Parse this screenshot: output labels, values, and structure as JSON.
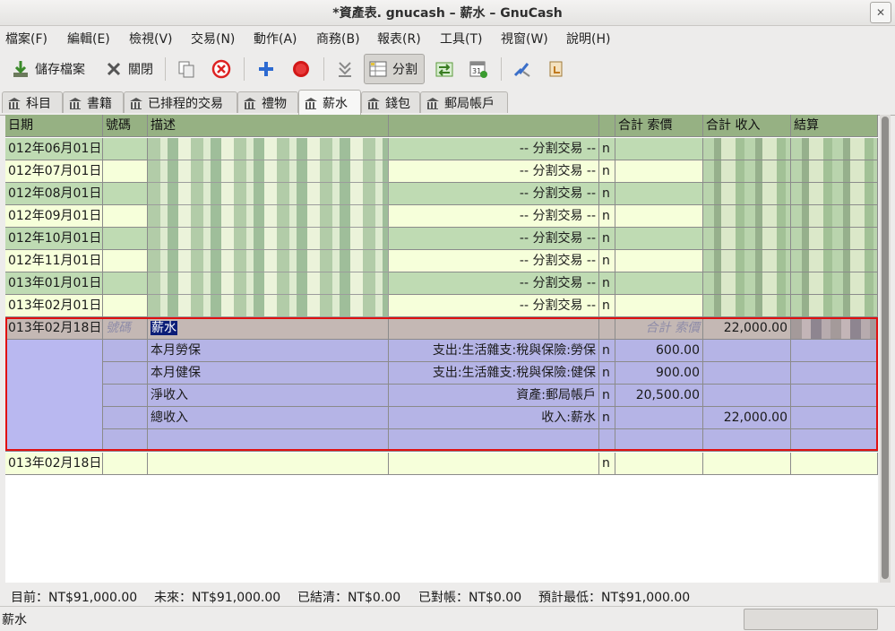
{
  "window": {
    "title": "*資產表. gnucash – 薪水  –  GnuCash"
  },
  "menu": [
    "檔案(F)",
    "編輯(E)",
    "檢視(V)",
    "交易(N)",
    "動作(A)",
    "商務(B)",
    "報表(R)",
    "工具(T)",
    "視窗(W)",
    "說明(H)"
  ],
  "toolbar": {
    "save": "儲存檔案",
    "close": "關閉",
    "split": "分割"
  },
  "tabs": [
    "科目",
    "書籍",
    "已排程的交易",
    "禮物",
    "薪水",
    "錢包",
    "郵局帳戶"
  ],
  "columns": {
    "date": "日期",
    "num": "號碼",
    "desc": "描述",
    "debit": "合計 索價",
    "credit": "合計 收入",
    "balance": "結算"
  },
  "split_label": "-- 分割交易 --",
  "reconcile": "n",
  "transactions": [
    {
      "date": "012年06月01日"
    },
    {
      "date": "012年07月01日"
    },
    {
      "date": "012年08月01日"
    },
    {
      "date": "012年09月01日"
    },
    {
      "date": "012年10月01日"
    },
    {
      "date": "012年11月01日"
    },
    {
      "date": "013年01月01日"
    },
    {
      "date": "013年02月01日"
    }
  ],
  "current": {
    "date": "013年02月18日",
    "num_placeholder": "號碼",
    "desc": "薪水",
    "debit_placeholder": "合計 索價",
    "credit": "22,000.00",
    "splits": [
      {
        "memo": "本月勞保",
        "account": "支出:生活雜支:稅與保險:勞保",
        "debit": "600.00",
        "credit": ""
      },
      {
        "memo": "本月健保",
        "account": "支出:生活雜支:稅與保險:健保",
        "debit": "900.00",
        "credit": ""
      },
      {
        "memo": "淨收入",
        "account": "資產:郵局帳戶",
        "debit": "20,500.00",
        "credit": ""
      },
      {
        "memo": "總收入",
        "account": "收入:薪水",
        "debit": "",
        "credit": "22,000.00"
      }
    ]
  },
  "blank_entry": {
    "date": "013年02月18日"
  },
  "summary": {
    "present": "目前：NT$91,000.00",
    "future": "未來：NT$91,000.00",
    "cleared": "已結清：NT$0.00",
    "reconciled": "已對帳：NT$0.00",
    "projected_min": "預計最低：NT$91,000.00"
  },
  "status": "薪水",
  "colors": {
    "header": "#96b183",
    "green_row": "#bfdbb3",
    "yellow_row": "#f6ffda",
    "split_row": "#b5b4e6",
    "selected": "#0b1d77",
    "highlight_box": "#e01010"
  }
}
